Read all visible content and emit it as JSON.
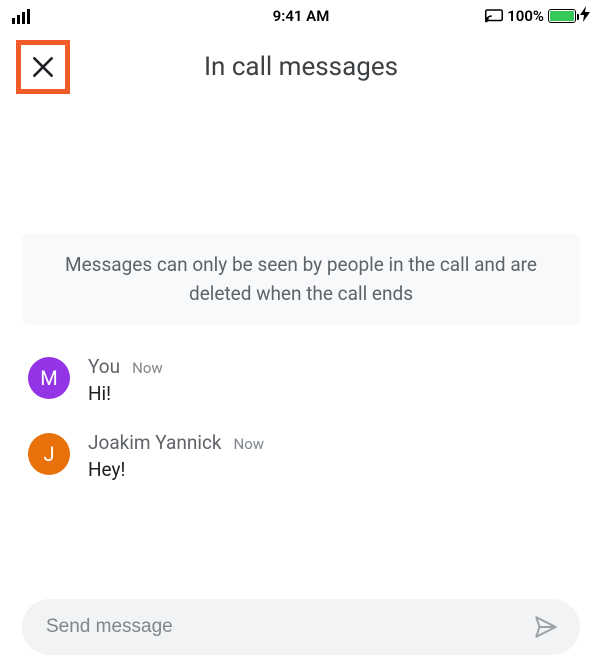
{
  "status": {
    "time": "9:41 AM",
    "battery_pct": "100%"
  },
  "header": {
    "title": "In call messages"
  },
  "info": {
    "text": "Messages can only be seen by people in the call and are deleted when the call ends"
  },
  "messages": [
    {
      "avatar_initial": "M",
      "avatar_color": "purple",
      "sender": "You",
      "time": "Now",
      "text": "Hi!"
    },
    {
      "avatar_initial": "J",
      "avatar_color": "orange",
      "sender": "Joakim Yannick",
      "time": "Now",
      "text": "Hey!"
    }
  ],
  "composer": {
    "placeholder": "Send message"
  }
}
